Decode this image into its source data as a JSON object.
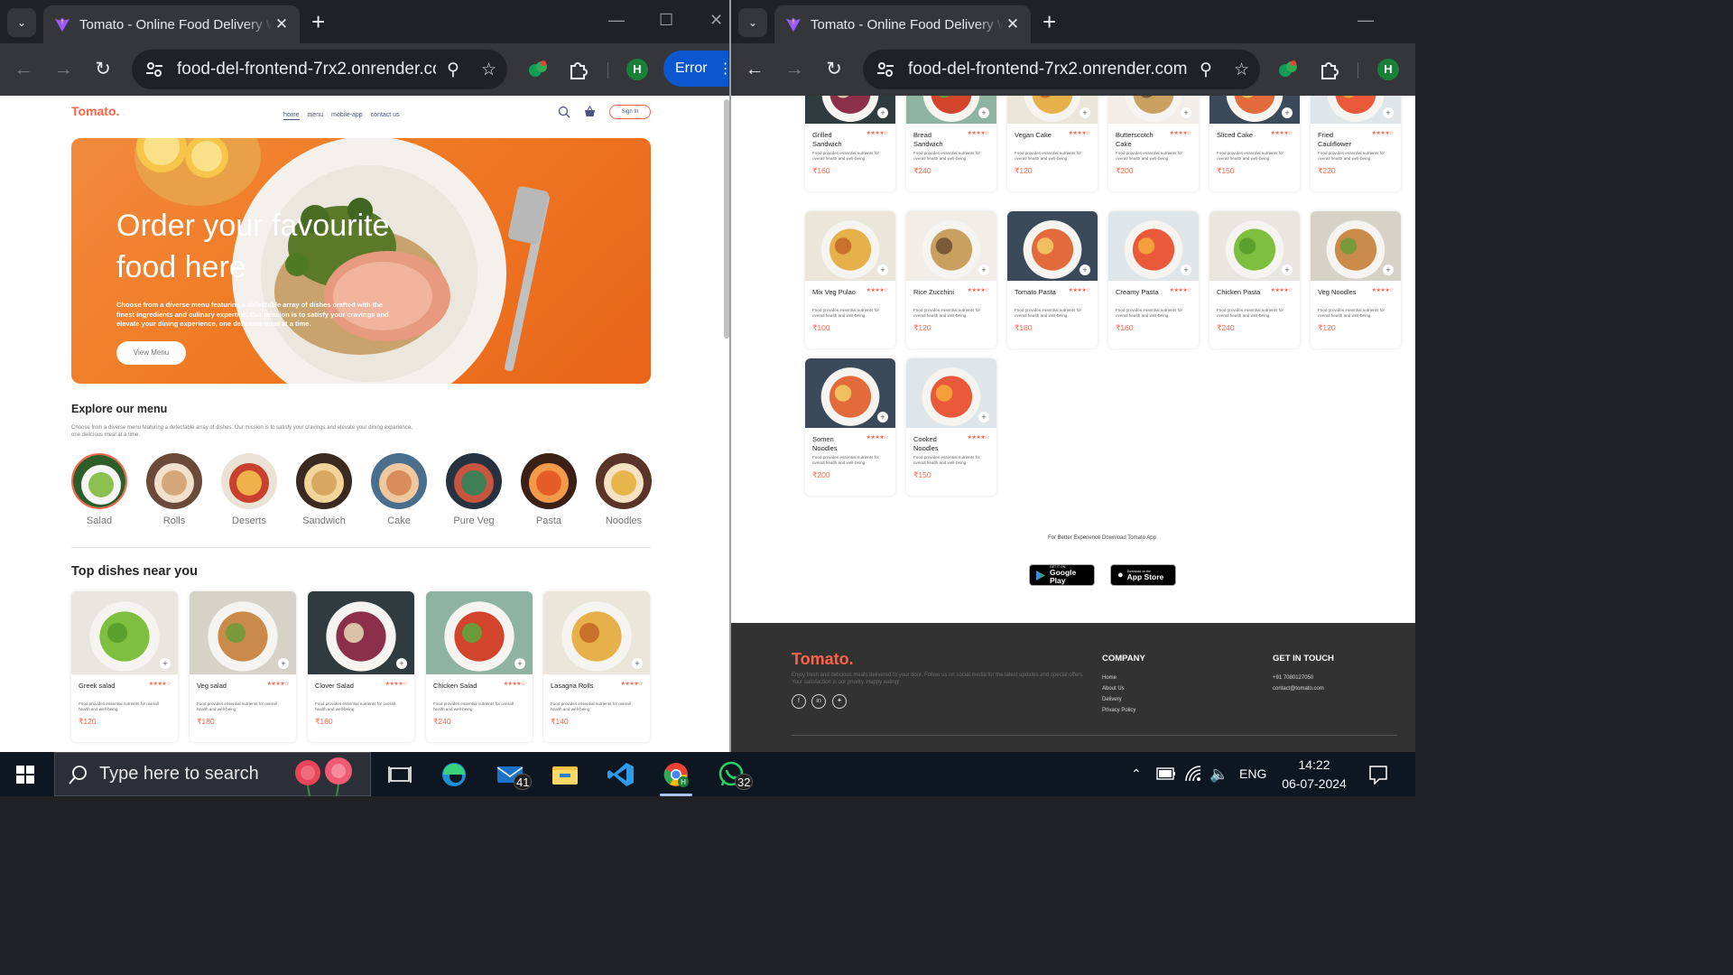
{
  "left_window": {
    "tab_title": "Tomato - Online Food Delivery Website",
    "url": "food-del-frontend-7rx2.onrender.co...",
    "profile_initial": "H",
    "error_label": "Error"
  },
  "right_window": {
    "tab_title": "Tomato - Online Food Delivery Website",
    "url": "food-del-frontend-7rx2.onrender.com",
    "profile_initial": "H"
  },
  "site": {
    "logo": "Tomato.",
    "nav": [
      "home",
      "menu",
      "mobile-app",
      "contact us"
    ],
    "sign_in": "Sign In",
    "hero_title": "Order your favourite food here",
    "hero_desc": "Choose from a diverse menu featuring a delectable array of dishes crafted with the finest ingredients and culinary expertise. Our mission is to satisfy your cravings and elevate your dining experience, one delicious meal at a time.",
    "hero_button": "View Menu",
    "explore_title": "Explore our menu",
    "explore_desc": "Choose from a diverse menu featuring a detectable array of dishes. Our mission is to satisfy your cravings and elevate your dining experience, one delicious meal at a time.",
    "categories": [
      "Salad",
      "Rolls",
      "Deserts",
      "Sandwich",
      "Cake",
      "Pure Veg",
      "Pasta",
      "Noodles"
    ],
    "top_dishes_title": "Top dishes near you",
    "dish_desc": "Food provides essential nutrients for overall health and well-being",
    "left_dishes": [
      {
        "name": "Greek salad",
        "price": "₹120"
      },
      {
        "name": "Veg salad",
        "price": "₹180"
      },
      {
        "name": "Clover Salad",
        "price": "₹160"
      },
      {
        "name": "Chicken Salad",
        "price": "₹240"
      },
      {
        "name": "Lasagna Rolls",
        "price": "₹140"
      }
    ],
    "right_row1": [
      {
        "name": "Grilled Sandwich",
        "price": "₹160"
      },
      {
        "name": "Bread Sandwich",
        "price": "₹240"
      },
      {
        "name": "Vegan Cake",
        "price": "₹120"
      },
      {
        "name": "Butterscotch Cake",
        "price": "₹200"
      },
      {
        "name": "Sliced Cake",
        "price": "₹150"
      },
      {
        "name": "Fried Cauliflower",
        "price": "₹220"
      }
    ],
    "right_row2": [
      {
        "name": "Mix Veg Pulao",
        "price": "₹100"
      },
      {
        "name": "Rice Zucchini",
        "price": "₹120"
      },
      {
        "name": "Tomato Pasta",
        "price": "₹180"
      },
      {
        "name": "Creamy Pasta",
        "price": "₹160"
      },
      {
        "name": "Chicken Pasta",
        "price": "₹240"
      },
      {
        "name": "Veg Noodles",
        "price": "₹120"
      }
    ],
    "right_row3": [
      {
        "name": "Somen Noodles",
        "price": "₹200"
      },
      {
        "name": "Cooked Noodles",
        "price": "₹150"
      }
    ],
    "rating_stars": "★★★★☆",
    "app_download": "For Better Experience Download Tomato App",
    "google_play_small": "GET IT ON",
    "google_play": "Google Play",
    "app_store_small": "Download on the",
    "app_store": "App Store",
    "footer": {
      "logo": "Tomato.",
      "desc": "Enjoy fresh and delicious meals delivered to your door. Follow us on social media for the latest updates and special offers. Your satisfaction is our priority. Happy eating!",
      "company_title": "COMPANY",
      "company_links": [
        "Home",
        "About Us",
        "Delivery",
        "Privacy Policy"
      ],
      "contact_title": "GET IN TOUCH",
      "phone": "+91 7080127050",
      "email": "contact@tomato.com"
    }
  },
  "taskbar": {
    "search_placeholder": "Type here to search",
    "mail_badge": "41",
    "whatsapp_badge": "32",
    "language": "ENG",
    "time": "14:22",
    "date": "06-07-2024"
  },
  "colors": {
    "brand": "#ff6347",
    "chrome_dark": "#202124",
    "chrome_toolbar": "#35363a",
    "footer_bg": "#323232",
    "taskbar_bg": "#0e1621"
  }
}
